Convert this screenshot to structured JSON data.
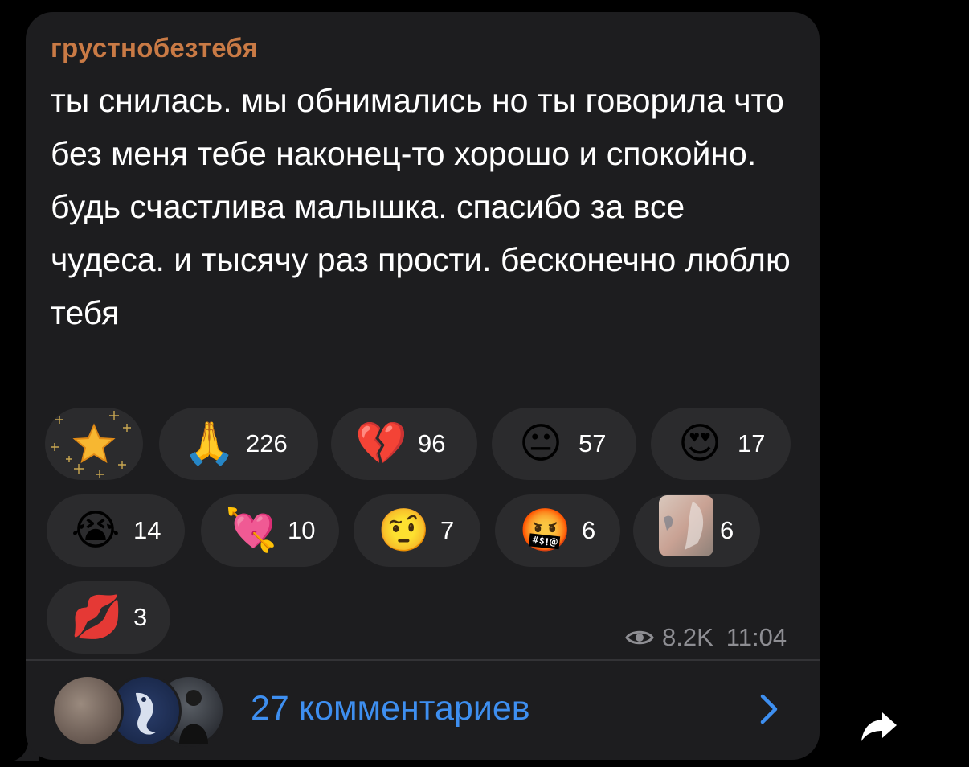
{
  "post": {
    "author": "грустнобезтебя",
    "text": "ты снилась. мы обнимались но ты говорила что без меня тебе наконец-то хорошо и спокойно. будь счастлива малышка. спасибо за все чудеса. и тысячу раз прости. бесконечно люблю тебя"
  },
  "reactions": [
    {
      "emoji": "⭐",
      "icon": "sparkle-star-icon",
      "count": ""
    },
    {
      "emoji": "🙏",
      "icon": "praying-hands-icon",
      "count": "226"
    },
    {
      "emoji": "💔",
      "icon": "broken-heart-icon",
      "count": "96"
    },
    {
      "emoji": "😐",
      "icon": "neutral-face-icon",
      "count": "57"
    },
    {
      "emoji": "😍",
      "icon": "heart-eyes-icon",
      "count": "17"
    },
    {
      "emoji": "😭",
      "icon": "crying-face-icon",
      "count": "14"
    },
    {
      "emoji": "💘",
      "icon": "heart-with-arrow-icon",
      "count": "10"
    },
    {
      "emoji": "🤨",
      "icon": "raised-eyebrow-icon",
      "count": "7"
    },
    {
      "emoji": "🤬",
      "icon": "cursing-face-icon",
      "count": "6"
    },
    {
      "emoji": "",
      "icon": "custom-sticker-icon",
      "count": "6"
    },
    {
      "emoji": "💋",
      "icon": "kiss-mark-icon",
      "count": "3"
    }
  ],
  "meta": {
    "views": "8.2K",
    "time": "11:04"
  },
  "comments": {
    "label": "27 комментариев"
  }
}
